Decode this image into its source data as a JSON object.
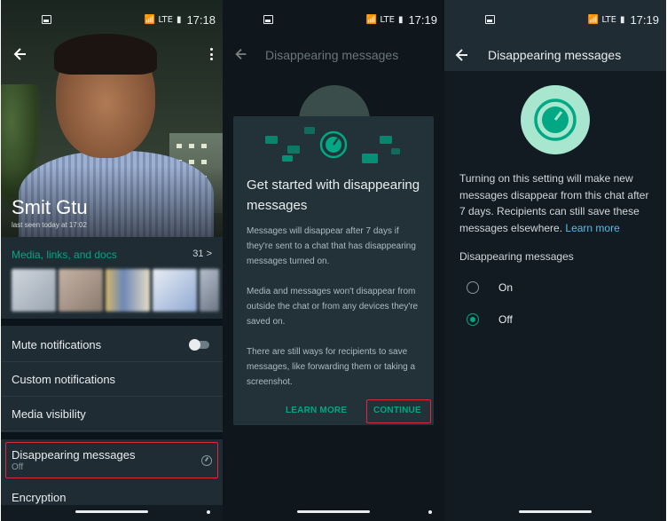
{
  "status": {
    "time1": "17:18",
    "time2": "17:19",
    "time3": "17:19",
    "network": "LTE"
  },
  "profile": {
    "name": "Smit Gtu",
    "last_seen": "last seen today at 17:02",
    "media_title": "Media, links, and docs",
    "media_count": "31 >",
    "thumb_colors": [
      "#cfd5dc",
      "#b9a89a",
      "#d9c79a",
      "#c8d6ea",
      "#a7b3c6"
    ]
  },
  "settings": {
    "mute": "Mute notifications",
    "custom": "Custom notifications",
    "media_visibility": "Media visibility",
    "disappearing": "Disappearing messages",
    "disappearing_value": "Off",
    "encryption": "Encryption"
  },
  "dialog": {
    "header": "Disappearing messages",
    "title": "Get started with disappearing messages",
    "p1": "Messages will disappear after 7 days if they're sent to a chat that has disappearing messages turned on.",
    "p2": "Media and messages won't disappear from outside the chat or from any devices they're saved on.",
    "p3": "There are still ways for recipients to save messages, like forwarding them or taking a screenshot.",
    "learn_more": "LEARN MORE",
    "continue": "CONTINUE"
  },
  "dm_screen": {
    "title": "Disappearing messages",
    "description": "Turning on this setting will make new messages disappear from this chat after 7 days. Recipients can still save these messages elsewhere.",
    "learn_more": "Learn more",
    "section": "Disappearing messages",
    "options": [
      "On",
      "Off"
    ],
    "selected": "Off"
  },
  "colors": {
    "accent": "#00a884",
    "highlight": "#d92b39",
    "link": "#53bdeb"
  }
}
